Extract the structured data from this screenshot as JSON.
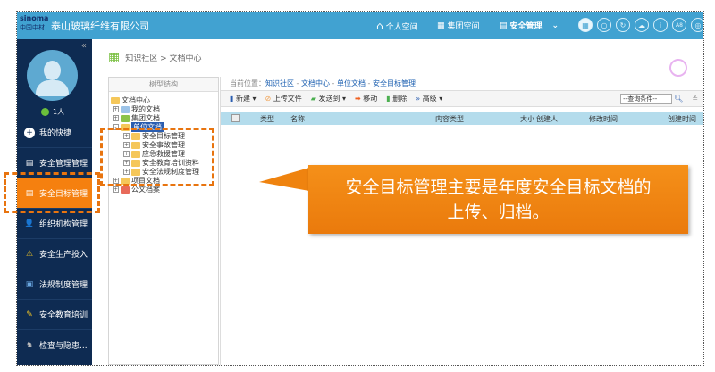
{
  "header": {
    "logo_en": "SINOMA",
    "logo_cn": "中国中材",
    "company": "泰山玻璃纤维有限公司",
    "nav": [
      {
        "label": "个人空间",
        "icon": "home-icon"
      },
      {
        "label": "集团空间",
        "icon": "group-icon"
      },
      {
        "label": "安全管理",
        "icon": "building-icon"
      }
    ],
    "circle_icons": [
      "grid-icon",
      "search-icon",
      "refresh-icon",
      "cloud-icon",
      "info-icon",
      "a8-icon",
      "settings-icon"
    ],
    "a8": "A8"
  },
  "sidebar": {
    "user_count": "1人",
    "collapse": "«",
    "items": [
      {
        "label": "我的快捷"
      },
      {
        "label": "安全管理管理"
      },
      {
        "label": "安全目标管理"
      },
      {
        "label": "组织机构管理"
      },
      {
        "label": "安全生产投入"
      },
      {
        "label": "法规制度管理"
      },
      {
        "label": "安全教育培训"
      },
      {
        "label": "检查与隐患..."
      }
    ]
  },
  "page": {
    "breadcrumb": "知识社区 > 文档中心"
  },
  "tree": {
    "title": "树型结构",
    "root": "文档中心",
    "nodes": [
      "我的文档",
      "集团文档",
      "单位文档",
      "安全目标管理",
      "安全事故管理",
      "应急救援管理",
      "安全教育培训资料",
      "安全法规制度管理",
      "项目文档",
      "公文档案"
    ]
  },
  "location": {
    "label": "当前位置：",
    "path": [
      "知识社区",
      "文档中心",
      "单位文档",
      "安全目标管理"
    ],
    "sep": " - "
  },
  "toolbar": {
    "new": "新建",
    "upload": "上传文件",
    "send": "发送到",
    "move": "移动",
    "delete": "删除",
    "advanced": "高级",
    "query_placeholder": "--查询条件--"
  },
  "table": {
    "columns": [
      "类型",
      "名称",
      "内容类型",
      "大小",
      "创建人",
      "修改时间",
      "创建时间"
    ]
  },
  "callout": {
    "line1": "安全目标管理主要是年度安全目标文档的",
    "line2": "上传、归档。"
  }
}
